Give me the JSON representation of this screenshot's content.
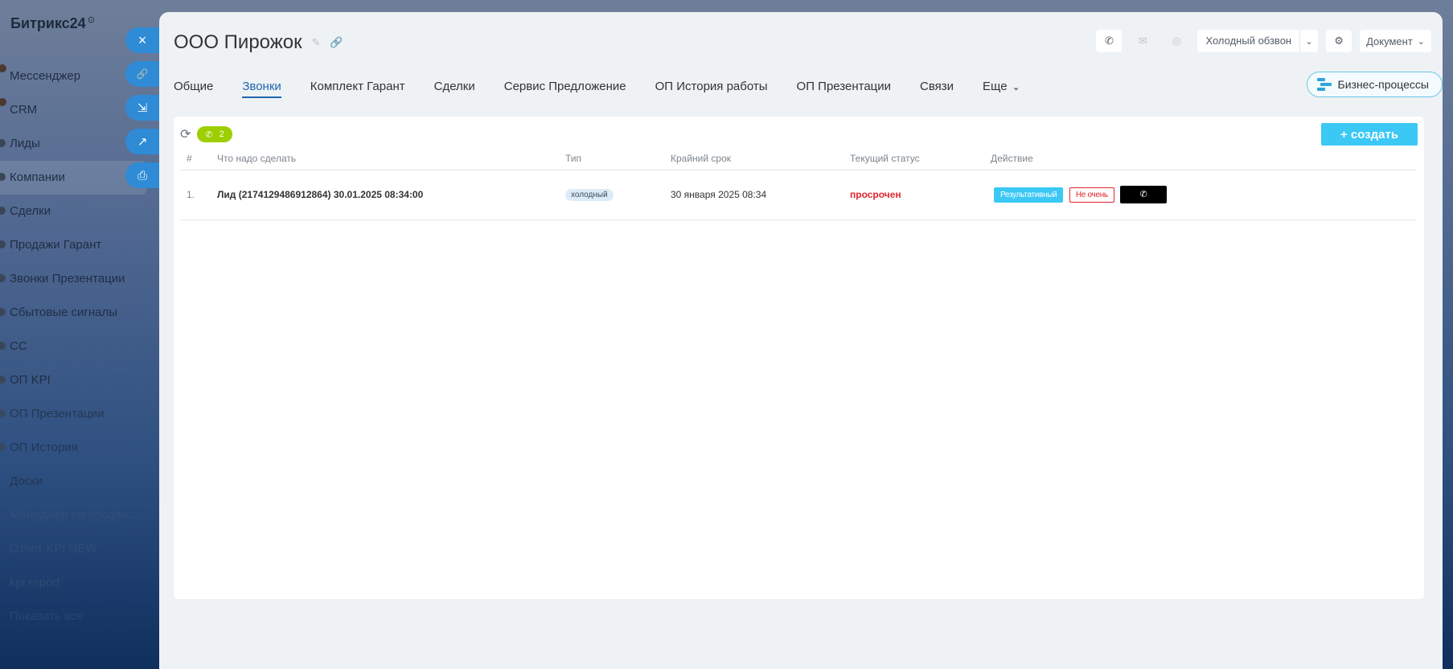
{
  "app": {
    "name": "Битрикс24"
  },
  "sidebar": {
    "items": [
      {
        "label": "Мессенджер"
      },
      {
        "label": "CRM"
      },
      {
        "label": "Лиды"
      },
      {
        "label": "Компании"
      },
      {
        "label": "Сделки"
      },
      {
        "label": "Продажи Гарант"
      },
      {
        "label": "Звонки Презентации"
      },
      {
        "label": "Сбытовые сигналы"
      },
      {
        "label": "СС"
      },
      {
        "label": "ОП KPI"
      },
      {
        "label": "ОП Презентации"
      },
      {
        "label": "ОП История"
      },
      {
        "label": "Доски"
      },
      {
        "label": "Менеджер по продаж..."
      },
      {
        "label": "Отчет KPI NEW"
      },
      {
        "label": "kpi report"
      },
      {
        "label": "Показать все"
      }
    ]
  },
  "side_actions": {
    "close": "×",
    "link": "🔗",
    "download": "⇲",
    "external": "↗",
    "print": "⎙"
  },
  "header": {
    "title": "ООО Пирожок",
    "title_icons": "✎ 🔗",
    "scenario": "Холодный обзвон",
    "document": "Документ",
    "icons": {
      "phone": "✆",
      "mail": "✉",
      "chat": "◎",
      "settings": "⚙"
    }
  },
  "tabs": [
    {
      "label": "Общие"
    },
    {
      "label": "Звонки"
    },
    {
      "label": "Комплект Гарант"
    },
    {
      "label": "Сделки"
    },
    {
      "label": "Сервис Предложение"
    },
    {
      "label": "ОП История работы"
    },
    {
      "label": "ОП Презентации"
    },
    {
      "label": "Связи"
    },
    {
      "label": "Еще"
    }
  ],
  "bp_button": "Бизнес-процессы",
  "card": {
    "count": "2",
    "create_label": "+ создать",
    "columns": {
      "num": "#",
      "task": "Что надо сделать",
      "type": "Тип",
      "deadline": "Крайний срок",
      "status": "Текущий статус",
      "action": "Действие"
    },
    "rows": [
      {
        "num": "1.",
        "task": "Лид (2174129486912864) 30.01.2025 08:34:00",
        "type": "холодный",
        "deadline": "30 января 2025 08:34",
        "status": "просрочен",
        "action_good": "Результативный",
        "action_bad": "Не очень"
      }
    ]
  }
}
